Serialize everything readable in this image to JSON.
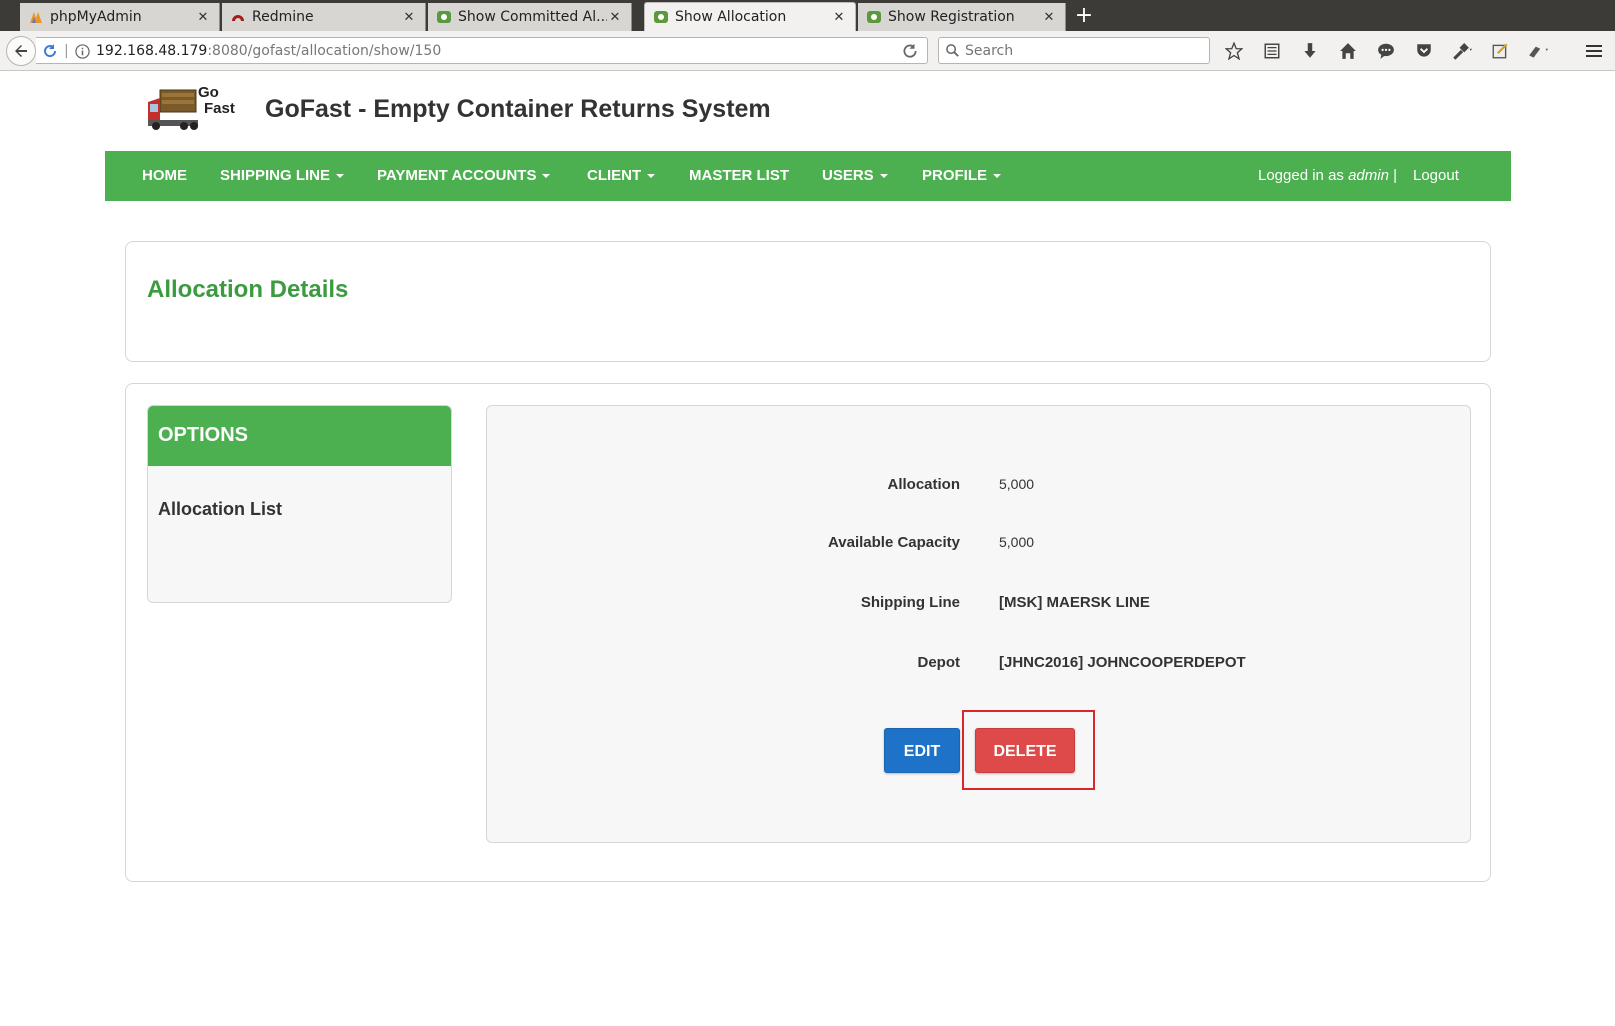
{
  "browser": {
    "tabs": [
      {
        "title": "phpMyAdmin",
        "icon": "phpmyadmin-icon",
        "active": false
      },
      {
        "title": "Redmine",
        "icon": "redmine-icon",
        "active": false
      },
      {
        "title": "Show Committed Al...",
        "icon": "grails-icon",
        "active": false
      },
      {
        "title": "Show Allocation",
        "icon": "grails-icon",
        "active": true
      },
      {
        "title": "Show Registration",
        "icon": "grails-icon",
        "active": false
      }
    ],
    "close_glyph": "✕",
    "new_tab_glyph": "+",
    "url_host": "192.168.48.179",
    "url_rest": ":8080/gofast/allocation/show/150",
    "search_placeholder": "Search"
  },
  "app": {
    "logo_text_line1": "Go",
    "logo_text_line2": "Fast",
    "title": "GoFast - Empty Container Returns System"
  },
  "nav": {
    "items": [
      {
        "label": "HOME",
        "dropdown": false
      },
      {
        "label": "SHIPPING LINE",
        "dropdown": true
      },
      {
        "label": "PAYMENT ACCOUNTS",
        "dropdown": true
      },
      {
        "label": "CLIENT",
        "dropdown": true
      },
      {
        "label": "MASTER LIST",
        "dropdown": false
      },
      {
        "label": "USERS",
        "dropdown": true
      },
      {
        "label": "PROFILE",
        "dropdown": true
      }
    ],
    "logged_in_prefix": "Logged in as",
    "logged_in_user": "admin",
    "logged_in_sep": "|",
    "logout_label": "Logout"
  },
  "page": {
    "heading": "Allocation Details",
    "options_title": "OPTIONS",
    "options_link": "Allocation List",
    "fields": [
      {
        "label": "Allocation",
        "value": "5,000"
      },
      {
        "label": "Available Capacity",
        "value": "5,000"
      },
      {
        "label": "Shipping Line",
        "value": "[MSK] MAERSK LINE"
      },
      {
        "label": "Depot",
        "value": "[JHNC2016] JOHNCOOPERDEPOT"
      }
    ],
    "edit_label": "EDIT",
    "delete_label": "DELETE"
  },
  "colors": {
    "nav_green": "#4caf50",
    "heading_green": "#3c9b40",
    "edit_blue": "#1e73c8",
    "delete_red": "#dd4a49",
    "highlight_red": "#d9272a"
  }
}
